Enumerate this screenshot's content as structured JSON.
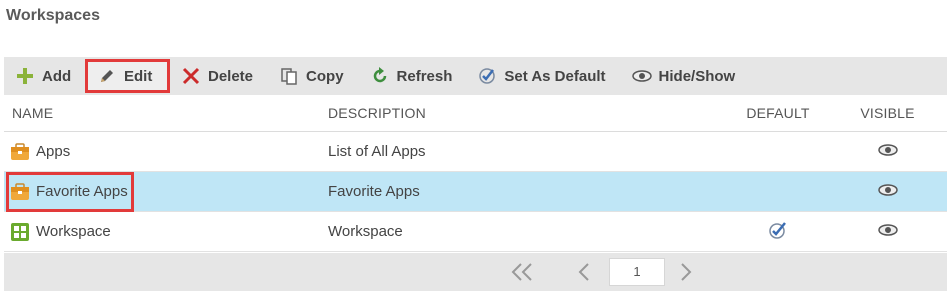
{
  "page": {
    "title": "Workspaces"
  },
  "toolbar": {
    "add_label": "Add",
    "edit_label": "Edit",
    "delete_label": "Delete",
    "copy_label": "Copy",
    "refresh_label": "Refresh",
    "set_default_label": "Set As Default",
    "hide_show_label": "Hide/Show"
  },
  "table": {
    "columns": [
      "NAME",
      "DESCRIPTION",
      "DEFAULT",
      "VISIBLE"
    ],
    "rows": [
      {
        "name": "Apps",
        "description": "List of All Apps",
        "icon": "briefcase-icon",
        "default": false,
        "visible": true
      },
      {
        "name": "Favorite Apps",
        "description": "Favorite Apps",
        "icon": "briefcase-icon",
        "default": false,
        "visible": true,
        "selected": true
      },
      {
        "name": "Workspace",
        "description": "Workspace",
        "icon": "grid-icon",
        "default": true,
        "visible": true
      }
    ]
  },
  "pager": {
    "page": "1"
  },
  "colors": {
    "selected_row": "#bfe6f6",
    "highlight": "#e23a3a",
    "toolbar_bg": "#e6e6e6"
  }
}
